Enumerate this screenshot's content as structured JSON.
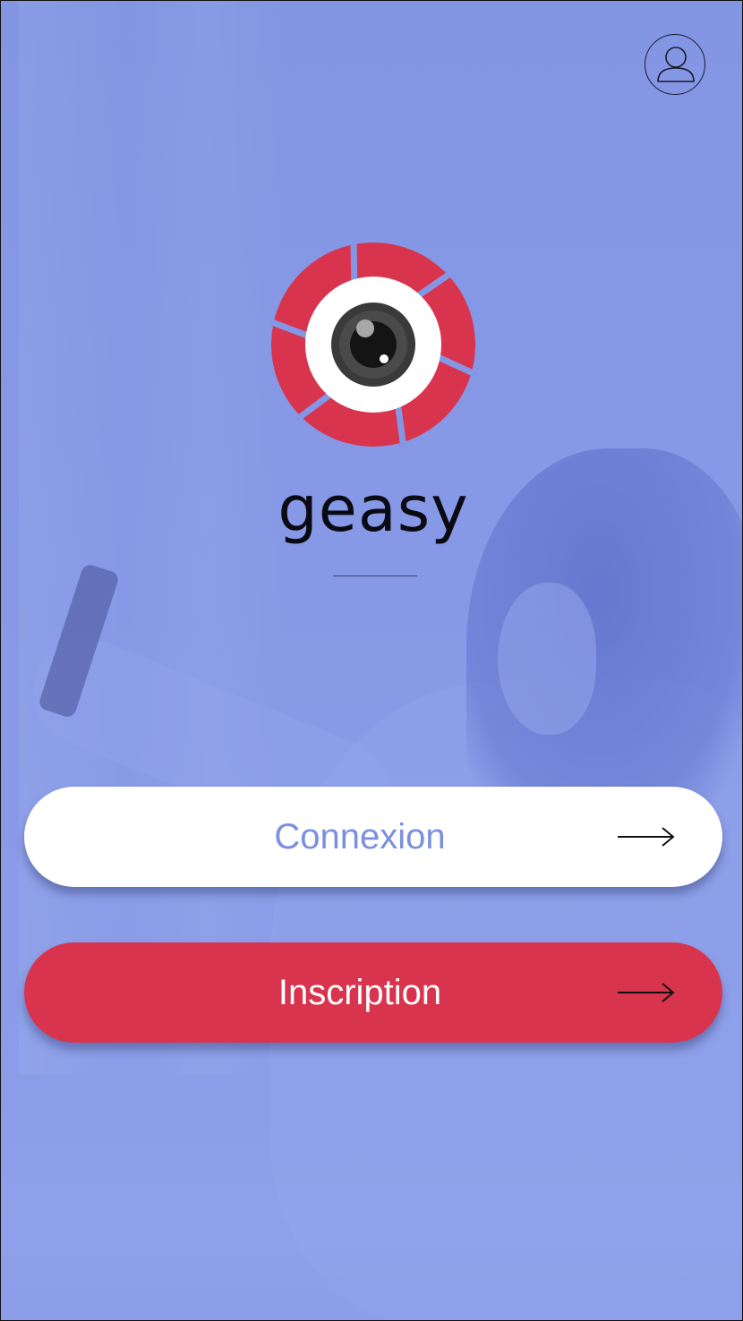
{
  "app": {
    "name": "geasy"
  },
  "header": {
    "profile_icon": "user-profile-icon"
  },
  "buttons": {
    "login_label": "Connexion",
    "signup_label": "Inscription",
    "arrow_icon": "arrow-right-icon"
  },
  "colors": {
    "background_overlay": "#8497e6",
    "accent_red": "#d9344e",
    "login_text": "#7c8fe0",
    "brand_text": "#0a0a12"
  }
}
